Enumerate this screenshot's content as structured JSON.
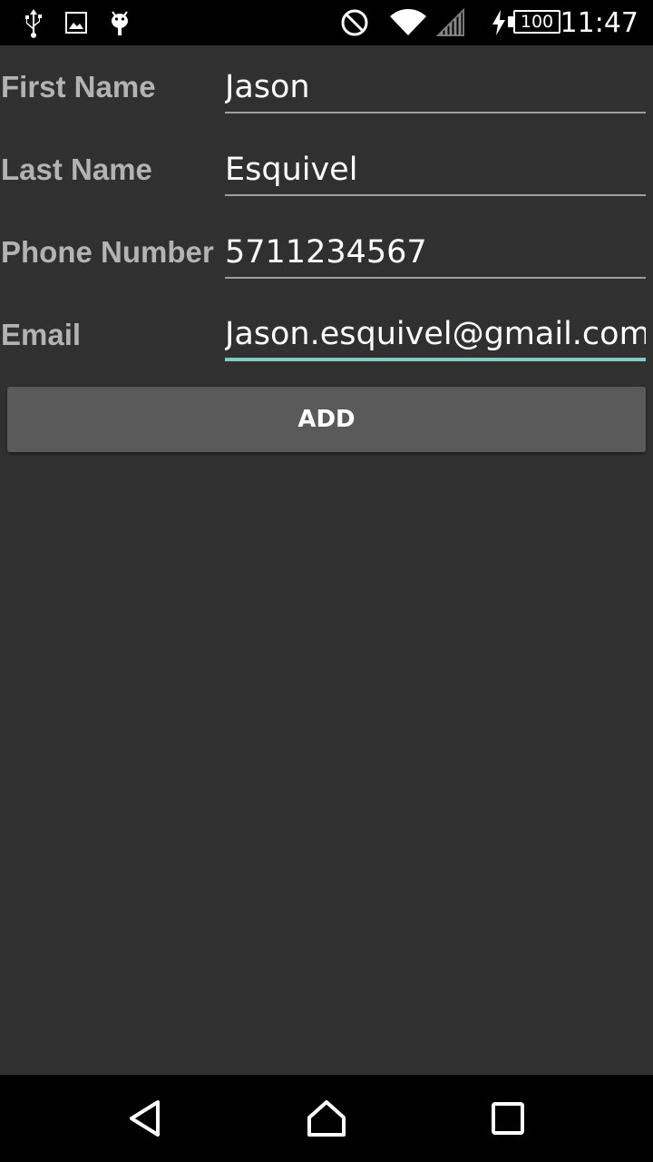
{
  "status_bar": {
    "time": "11:47",
    "battery_level": "100",
    "icons": [
      "usb-icon",
      "image-icon",
      "android-icon",
      "do-not-disturb-icon",
      "wifi-icon",
      "signal-icon",
      "charging-icon",
      "battery-icon"
    ]
  },
  "form": {
    "first_name": {
      "label": "First Name",
      "value": "Jason"
    },
    "last_name": {
      "label": "Last Name",
      "value": "Esquivel"
    },
    "phone": {
      "label": "Phone Number",
      "value": "5711234567"
    },
    "email": {
      "label": "Email",
      "value": "Jason.esquivel@gmail.com"
    }
  },
  "add_button": {
    "label": "ADD"
  },
  "colors": {
    "background": "#303030",
    "button": "#5a5a5b",
    "accent_underline": "#80cbc4",
    "label": "#b3b3b3"
  },
  "nav_bar": {
    "icons": [
      "back-icon",
      "home-icon",
      "recents-icon"
    ]
  }
}
